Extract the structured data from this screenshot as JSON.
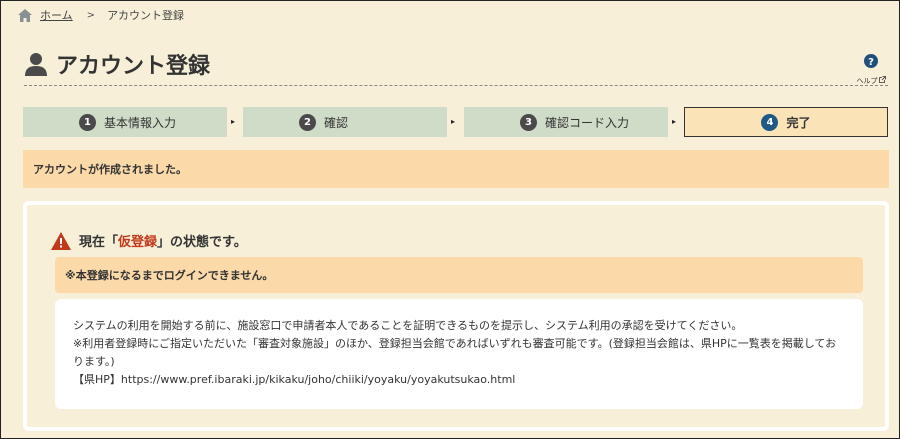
{
  "breadcrumb": {
    "home": "ホーム",
    "current": "アカウント登録"
  },
  "header": {
    "title": "アカウント登録",
    "help_label": "ヘルプ"
  },
  "steps": [
    {
      "num": "1",
      "label": "基本情報入力"
    },
    {
      "num": "2",
      "label": "確認"
    },
    {
      "num": "3",
      "label": "確認コード入力"
    },
    {
      "num": "4",
      "label": "完了"
    }
  ],
  "notice": "アカウントが作成されました。",
  "status": {
    "prefix": "現在「",
    "highlight": "仮登録",
    "suffix": "」の状態です。"
  },
  "warning": "※本登録になるまでログインできません。",
  "info": {
    "line1": "システムの利用を開始する前に、施設窓口で申請者本人であることを証明できるものを提示し、システム利用の承認を受けてください。",
    "line2": "※利用者登録時にご指定いただいた「審査対象施設」のほか、登録担当会館であればいずれも審査可能です。(登録担当会館は、県HPに一覧表を掲載しております。)",
    "line3": "【県HP】https://www.pref.ibaraki.jp/kikaku/joho/chiiki/yoyaku/yoyakutsukao.html"
  },
  "colors": {
    "background": "#f7efd8",
    "step": "#cfdcc8",
    "step_active": "#fbe3b8",
    "notice": "#fbd9a9",
    "highlight": "#c0391b",
    "step_active_num": "#1f5a87"
  }
}
